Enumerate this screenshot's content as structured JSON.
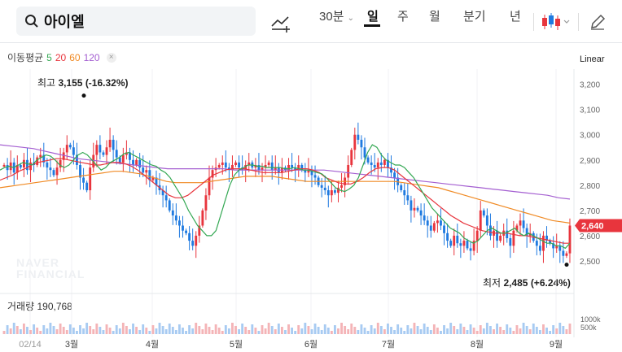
{
  "search": {
    "query": "아이엘"
  },
  "toolbar": {
    "interval_label": "30분",
    "periods": [
      "일",
      "주",
      "월",
      "분기",
      "년"
    ],
    "active_period": "일"
  },
  "ma_legend": {
    "title": "이동평균",
    "periods": [
      "5",
      "20",
      "60",
      "120"
    ]
  },
  "colors": {
    "up": "#e8353d",
    "down": "#1f7ae0",
    "ma5": "#34a853",
    "ma20": "#e8353d",
    "ma60": "#f08a24",
    "ma120": "#a45fd1",
    "current_badge": "#e8353d"
  },
  "watermark": {
    "line1": "NAVER",
    "line2": "FINANCIAL"
  },
  "chart_data": {
    "type": "candlestick",
    "scale": "Linear",
    "ylim": [
      2400,
      3260
    ],
    "y_ticks": [
      "3,200",
      "3,100",
      "3,000",
      "2,900",
      "2,800",
      "2,700",
      "2,600",
      "2,500"
    ],
    "x_labels": [
      "02/14",
      "3월",
      "4월",
      "5월",
      "6월",
      "7월",
      "8월",
      "9월"
    ],
    "high_annotation": {
      "label": "최고",
      "value": "3,155",
      "change": "(-16.32%)"
    },
    "low_annotation": {
      "label": "최저",
      "value": "2,485",
      "change": "(+6.24%)"
    },
    "current_price": "2,640",
    "volume": {
      "label": "거래량",
      "value": "190,768",
      "ticks": [
        "1000k",
        "500k"
      ]
    },
    "candles_close": [
      2880,
      2860,
      2890,
      2850,
      2880,
      2870,
      2900,
      2860,
      2890,
      2880,
      2910,
      2920,
      2890,
      2870,
      2860,
      2840,
      2870,
      2900,
      2930,
      2960,
      2950,
      2920,
      2880,
      2830,
      2810,
      2780,
      2870,
      2920,
      2960,
      2930,
      2920,
      2950,
      2980,
      2940,
      2910,
      2890,
      2920,
      2930,
      2900,
      2880,
      2900,
      2870,
      2850,
      2860,
      2820,
      2830,
      2800,
      2780,
      2760,
      2740,
      2700,
      2680,
      2660,
      2640,
      2620,
      2610,
      2580,
      2560,
      2600,
      2640,
      2700,
      2760,
      2830,
      2860,
      2870,
      2880,
      2890,
      2870,
      2860,
      2880,
      2890,
      2870,
      2860,
      2880,
      2890,
      2870,
      2880,
      2860,
      2870,
      2880,
      2890,
      2860,
      2870,
      2850,
      2870,
      2860,
      2880,
      2870,
      2860,
      2880,
      2860,
      2850,
      2860,
      2840,
      2830,
      2800,
      2790,
      2780,
      2760,
      2780,
      2770,
      2790,
      2800,
      2830,
      2880,
      2940,
      3000,
      2980,
      2950,
      2910,
      2890,
      2880,
      2870,
      2890,
      2880,
      2900,
      2870,
      2850,
      2830,
      2800,
      2780,
      2760,
      2740,
      2700,
      2710,
      2700,
      2680,
      2660,
      2640,
      2620,
      2650,
      2660,
      2640,
      2610,
      2580,
      2560,
      2600,
      2570,
      2560,
      2580,
      2550,
      2540,
      2580,
      2620,
      2700,
      2680,
      2640,
      2600,
      2620,
      2580,
      2600,
      2620,
      2590,
      2560,
      2620,
      2640,
      2660,
      2630,
      2600,
      2610,
      2580,
      2560,
      2540,
      2600,
      2580,
      2570,
      2550,
      2560,
      2540,
      2520,
      2530,
      2640
    ],
    "moving_averages": {
      "ma5": [
        2860,
        2870,
        2875,
        2870,
        2880,
        2890,
        2885,
        2880,
        2900,
        2910,
        2920,
        2915,
        2900,
        2880,
        2870,
        2880,
        2900,
        2920,
        2930,
        2920,
        2900,
        2880,
        2860,
        2870,
        2890,
        2900,
        2910,
        2925,
        2930,
        2920,
        2910,
        2900,
        2890,
        2880,
        2875,
        2860,
        2850,
        2830,
        2800,
        2770,
        2740,
        2700,
        2670,
        2640,
        2620,
        2600,
        2600,
        2620,
        2680,
        2740,
        2800,
        2840,
        2860,
        2870,
        2880,
        2880,
        2875,
        2875,
        2870,
        2870,
        2870,
        2870,
        2865,
        2865,
        2870,
        2865,
        2860,
        2860,
        2855,
        2850,
        2845,
        2830,
        2810,
        2790,
        2780,
        2775,
        2785,
        2800,
        2830,
        2880,
        2930,
        2960,
        2950,
        2920,
        2900,
        2890,
        2880,
        2880,
        2870,
        2850,
        2830,
        2800,
        2770,
        2740,
        2710,
        2690,
        2670,
        2650,
        2630,
        2620,
        2610,
        2590,
        2580,
        2570,
        2580,
        2600,
        2620,
        2630,
        2620,
        2610,
        2610,
        2620,
        2630,
        2610,
        2600,
        2610,
        2600,
        2590,
        2580,
        2570,
        2570,
        2560,
        2560,
        2550,
        2570
      ],
      "ma20": [
        2820,
        2830,
        2840,
        2855,
        2865,
        2880,
        2890,
        2895,
        2900,
        2905,
        2905,
        2900,
        2895,
        2890,
        2885,
        2880,
        2880,
        2885,
        2890,
        2890,
        2885,
        2875,
        2860,
        2840,
        2820,
        2800,
        2780,
        2760,
        2750,
        2750,
        2760,
        2780,
        2800,
        2820,
        2840,
        2850,
        2860,
        2865,
        2865,
        2865,
        2860,
        2855,
        2850,
        2850,
        2850,
        2850,
        2855,
        2860,
        2865,
        2865,
        2860,
        2850,
        2830,
        2820,
        2810,
        2805,
        2805,
        2815,
        2830,
        2850,
        2865,
        2870,
        2870,
        2860,
        2840,
        2820,
        2800,
        2780,
        2760,
        2740,
        2720,
        2700,
        2680,
        2665,
        2650,
        2640,
        2630,
        2620,
        2615,
        2610,
        2610,
        2610,
        2605,
        2600,
        2600,
        2595,
        2590,
        2585,
        2580,
        2575,
        2570,
        2570
      ],
      "ma60": [
        2790,
        2795,
        2800,
        2805,
        2810,
        2815,
        2820,
        2825,
        2830,
        2835,
        2840,
        2845,
        2850,
        2855,
        2855,
        2850,
        2845,
        2835,
        2825,
        2815,
        2810,
        2810,
        2810,
        2810,
        2815,
        2820,
        2825,
        2830,
        2835,
        2835,
        2835,
        2835,
        2830,
        2825,
        2820,
        2815,
        2815,
        2815,
        2815,
        2815,
        2815,
        2815,
        2815,
        2815,
        2815,
        2815,
        2810,
        2805,
        2800,
        2795,
        2790,
        2780,
        2770,
        2760,
        2750,
        2740,
        2730,
        2720,
        2710,
        2700,
        2690,
        2680,
        2670,
        2660,
        2655,
        2650
      ],
      "ma120": [
        2960,
        2955,
        2950,
        2945,
        2935,
        2925,
        2915,
        2905,
        2900,
        2895,
        2890,
        2885,
        2880,
        2875,
        2870,
        2865,
        2865,
        2865,
        2865,
        2865,
        2865,
        2860,
        2860,
        2860,
        2860,
        2860,
        2860,
        2860,
        2860,
        2860,
        2855,
        2850,
        2845,
        2840,
        2835,
        2830,
        2825,
        2820,
        2815,
        2810,
        2805,
        2800,
        2795,
        2790,
        2785,
        2780,
        2775,
        2770,
        2765,
        2760,
        2750,
        2745
      ]
    }
  }
}
